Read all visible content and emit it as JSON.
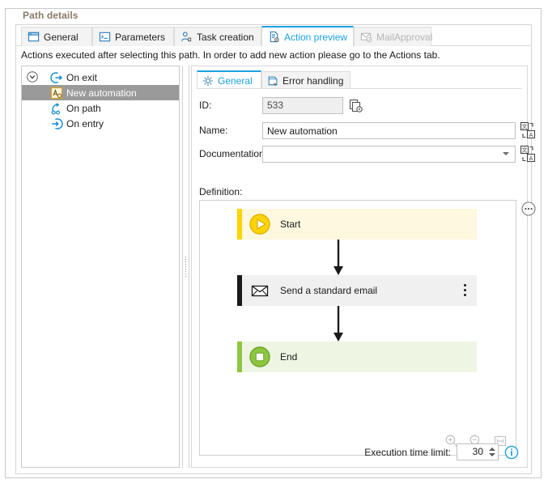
{
  "groupbox": {
    "title": "Path details"
  },
  "tabs": [
    {
      "label": "General",
      "icon": "window-icon",
      "active": false,
      "disabled": false
    },
    {
      "label": "Parameters",
      "icon": "console-icon",
      "active": false,
      "disabled": false
    },
    {
      "label": "Task creation",
      "icon": "person-task-icon",
      "active": false,
      "disabled": false
    },
    {
      "label": "Action preview",
      "icon": "document-gear-icon",
      "active": true,
      "disabled": false
    },
    {
      "label": "MailApproval",
      "icon": "mail-check-icon",
      "active": false,
      "disabled": true
    }
  ],
  "description": "Actions executed after selecting this path. In order to add new action please go to the Actions tab.",
  "tree": {
    "items": [
      {
        "label": "On exit",
        "icon": "on-exit-icon",
        "indent": 0,
        "expander": "collapse-icon",
        "selected": false
      },
      {
        "label": "New automation",
        "icon": "automation-icon",
        "indent": 1,
        "expander": "",
        "selected": true
      },
      {
        "label": "On path",
        "icon": "on-path-icon",
        "indent": 0,
        "expander": "",
        "selected": false
      },
      {
        "label": "On entry",
        "icon": "on-entry-icon",
        "indent": 0,
        "expander": "",
        "selected": false
      }
    ]
  },
  "detail": {
    "subtabs": [
      {
        "label": "General",
        "icon": "gear-icon",
        "active": true
      },
      {
        "label": "Error handling",
        "icon": "error-document-icon",
        "active": false
      }
    ],
    "fields": {
      "id_label": "ID:",
      "id_value": "533",
      "id_action_icon": "copy-settings-icon",
      "name_label": "Name:",
      "name_value": "New automation",
      "name_placeholder": "",
      "name_action_icon": "translate-icon",
      "documentation_label": "Documentation:",
      "documentation_value": "",
      "documentation_placeholder": "",
      "documentation_action_icon": "translate-icon",
      "definition_label": "Definition:"
    },
    "canvas": {
      "menu_icon": "more-options-icon",
      "nodes": [
        {
          "type": "start",
          "label": "Start",
          "icon": "play-icon",
          "accent": "#ffd400",
          "fill": "#fdf8de",
          "kebab": false
        },
        {
          "type": "action",
          "label": "Send a standard email",
          "icon": "email-icon",
          "accent": "#1a1a1a",
          "fill": "#f0f0f0",
          "kebab": true
        },
        {
          "type": "end",
          "label": "End",
          "icon": "stop-icon",
          "accent": "#8dc63f",
          "fill": "#eef6e3",
          "kebab": false
        }
      ],
      "zoom_tools": [
        {
          "name": "zoom-in-icon",
          "label": ""
        },
        {
          "name": "zoom-out-icon",
          "label": ""
        },
        {
          "name": "fit-width-icon",
          "label": ""
        }
      ]
    },
    "footer": {
      "exec_limit_label": "Execution time limit:",
      "exec_limit_value": "30",
      "info_icon": "info-icon"
    }
  },
  "colors": {
    "accent": "#1ba1e2",
    "start": "#ffd400",
    "end": "#8dc63f",
    "action": "#1a1a1a",
    "selection": "#9a9a9a"
  }
}
